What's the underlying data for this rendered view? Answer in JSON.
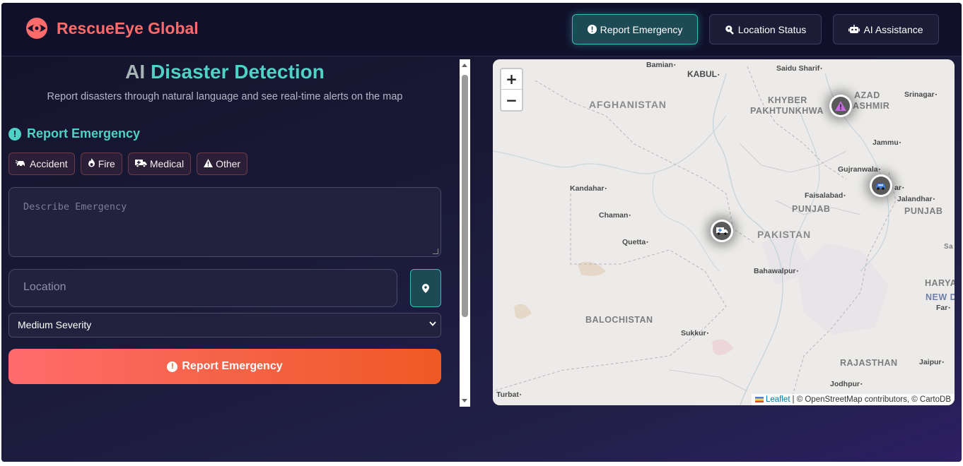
{
  "header": {
    "brand": "RescueEye Global",
    "brand_color": "#ff6b6b",
    "nav": [
      {
        "label": "Report Emergency",
        "icon": "exclamation-circle-icon",
        "active": true
      },
      {
        "label": "Location Status",
        "icon": "search-location-icon",
        "active": false
      },
      {
        "label": "AI Assistance",
        "icon": "robot-icon",
        "active": false
      }
    ]
  },
  "left": {
    "title_part1": "AI",
    "title_part2": "Disaster Detection",
    "subtitle": "Report disasters through natural language and see real-time alerts on the map",
    "section_title": "Report Emergency",
    "chips": [
      {
        "label": "Accident",
        "icon": "car-crash-icon"
      },
      {
        "label": "Fire",
        "icon": "fire-icon"
      },
      {
        "label": "Medical",
        "icon": "ambulance-icon"
      },
      {
        "label": "Other",
        "icon": "warning-icon"
      }
    ],
    "description_placeholder": "Describe Emergency",
    "location_placeholder": "Location",
    "severity_value": "Medium Severity",
    "submit_label": "Report Emergency"
  },
  "map": {
    "zoom_in": "+",
    "zoom_out": "−",
    "countries": [
      "AFGHANISTAN",
      "PAKISTAN"
    ],
    "regions": [
      "KHYBER",
      "PAKHTUNKHWA",
      "AZAD",
      "ASHMIR",
      "PUNJAB",
      "PUNJAB",
      "BALOCHISTAN",
      "RAJASTHAN",
      "HARYAN",
      "NEW D",
      "Sa"
    ],
    "cities": [
      "Bamian",
      "KABUL",
      "Saidu Sharif",
      "Srinagar",
      "Jammu",
      "Gujranwala",
      "Kandahar",
      "Faisalabad",
      "ar",
      "Jalandhar",
      "Chaman",
      "Quetta",
      "Bahawalpur",
      "Sukkur",
      "Jaipur",
      "Jodhpur",
      "Turbat",
      "Far"
    ],
    "markers": [
      {
        "type": "Other",
        "icon": "warning-icon"
      },
      {
        "type": "Accident",
        "icon": "car-icon"
      },
      {
        "type": "Medical",
        "icon": "ambulance-icon"
      }
    ],
    "attribution_leaflet": "Leaflet",
    "attribution_rest": "| © OpenStreetMap contributors, © CartoDB"
  }
}
